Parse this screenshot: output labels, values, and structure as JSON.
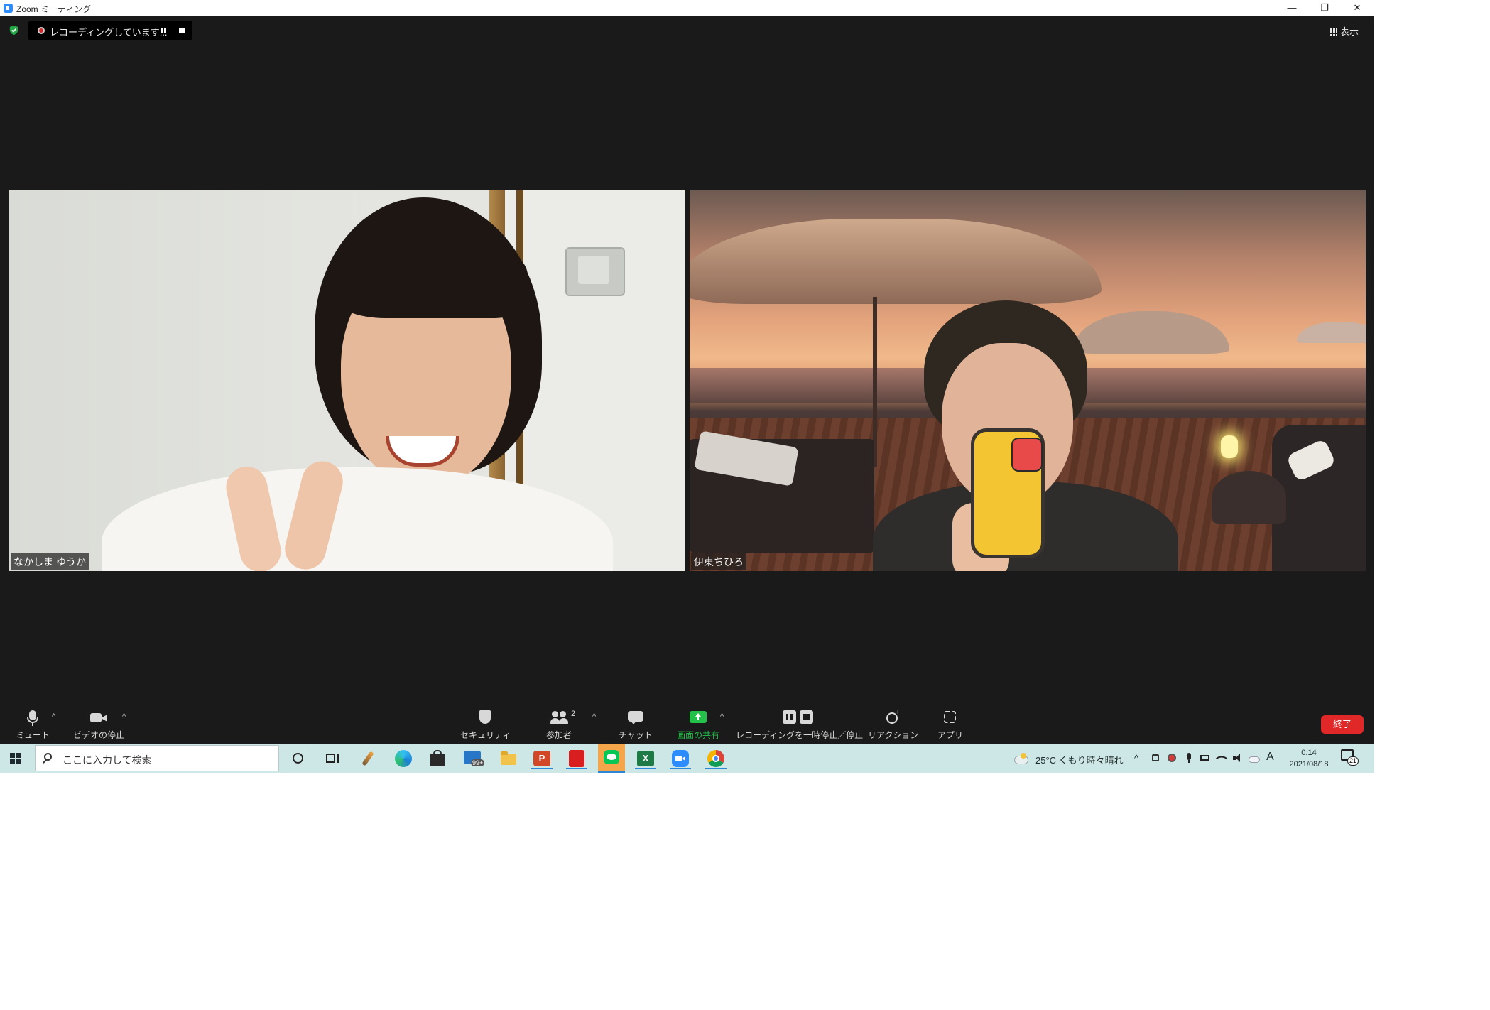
{
  "window": {
    "title": "Zoom ミーティング",
    "minimize": "—",
    "restore": "❐",
    "close": "✕"
  },
  "topbar": {
    "recording_text": "レコーディングしています...",
    "view_label": "表示"
  },
  "participants": [
    {
      "name": "なかしま ゆうか"
    },
    {
      "name": "伊東ちひろ"
    }
  ],
  "toolbar": {
    "mute": "ミュート",
    "video_stop": "ビデオの停止",
    "security": "セキュリティ",
    "participants": "参加者",
    "participants_count": "2",
    "chat": "チャット",
    "share_screen": "画面の共有",
    "recording_control": "レコーディングを一時停止／停止",
    "reactions": "リアクション",
    "apps": "アプリ",
    "end": "終了",
    "caret": "^"
  },
  "taskbar": {
    "search_placeholder": "ここに入力して検索",
    "mail_badge": "99+",
    "weather": "25°C くもり時々晴れ",
    "time": "0:14",
    "date": "2021/08/18",
    "ime": "A",
    "notifications": "21"
  },
  "colors": {
    "share_green": "#23c04a",
    "end_red": "#e02828",
    "taskbar_bg": "#cde7e7",
    "window_bg": "#1a1a1a"
  }
}
